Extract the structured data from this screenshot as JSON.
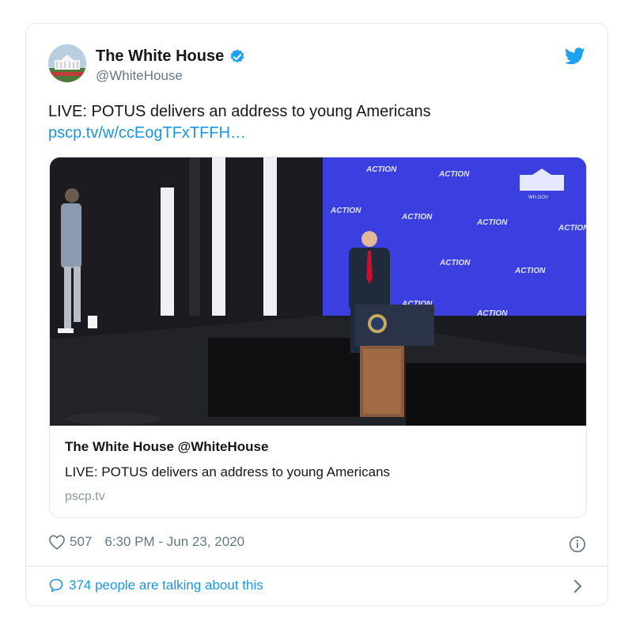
{
  "tweet": {
    "author_name": "The White House",
    "author_handle": "@WhiteHouse",
    "text": "LIVE: POTUS delivers an address to young Americans",
    "link": "pscp.tv/w/ccEogTFxTFFH…",
    "likes": "507",
    "timestamp": "6:30 PM - Jun 23, 2020",
    "talking": "374 people are talking about this"
  },
  "media_card": {
    "title": "The White House @WhiteHouse",
    "description": "LIVE: POTUS delivers an address to young Americans",
    "domain": "pscp.tv",
    "backdrop_text": "ACTION",
    "seal_caption": "WH.GOV"
  },
  "colors": {
    "link_blue": "#1b95e0",
    "verified_blue": "#1da1f2",
    "backdrop_blue": "#3b3fe0",
    "muted_gray": "#657786",
    "border": "#e1e8ed"
  },
  "icons": [
    "verified-badge-icon",
    "twitter-bird-icon",
    "heart-icon",
    "info-icon",
    "chat-bubble-icon",
    "chevron-right-icon"
  ]
}
